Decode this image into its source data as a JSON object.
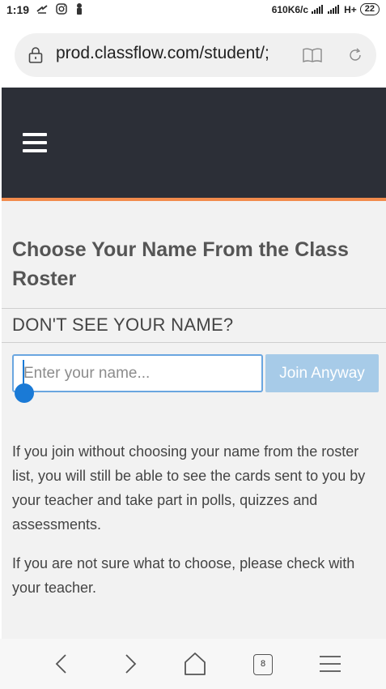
{
  "status_bar": {
    "time": "1:19",
    "network_speed": "610K6/c",
    "network_type": "H+",
    "battery": "22"
  },
  "browser": {
    "url": "prod.classflow.com/student/;",
    "tab_count": "8"
  },
  "page": {
    "title": "Choose Your Name From the Class Roster",
    "section_heading": "DON'T SEE YOUR NAME?",
    "name_input": {
      "placeholder": "Enter your name...",
      "value": ""
    },
    "join_button_label": "Join Anyway",
    "info_paragraph_1": "If you join without choosing your name from the roster list, you will still be able to see the cards sent to you by your teacher and take part in polls, quizzes and assessments.",
    "info_paragraph_2": "If you are not sure what to choose, please check with your teacher."
  },
  "colors": {
    "header_bg": "#2c2f37",
    "header_accent": "#f28b4c",
    "join_button_bg": "#a7cbe8",
    "input_focus_border": "#6aa6e0"
  },
  "icons": {
    "status_left": [
      "notification-icon",
      "instagram-icon",
      "person-icon"
    ],
    "url_bar": [
      "lock-icon",
      "reader-mode-icon",
      "reload-icon"
    ],
    "bottom_nav": [
      "back-icon",
      "forward-icon",
      "home-icon",
      "tabs-icon",
      "menu-icon"
    ]
  }
}
